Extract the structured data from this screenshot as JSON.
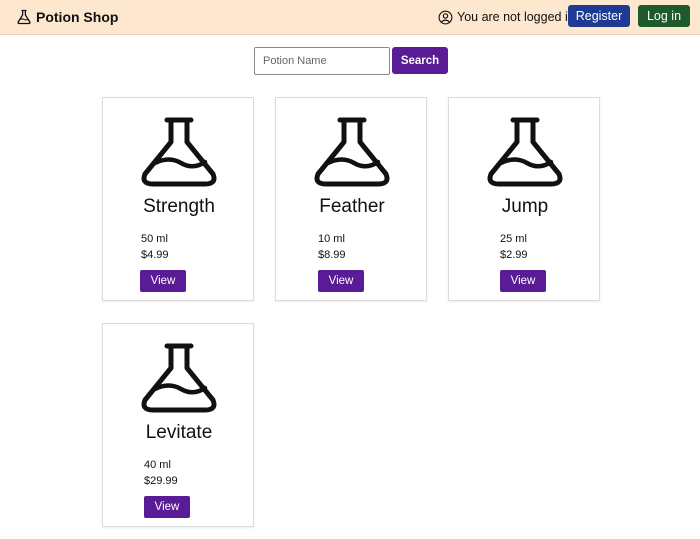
{
  "navbar": {
    "brand": "Potion Shop",
    "brand_icon": "flask-icon",
    "status_text": "You are not logged in",
    "status_icon": "user-circle-icon",
    "register_label": "Register",
    "login_label": "Log in",
    "colors": {
      "background": "#fde8cf",
      "register": "#1f3a93",
      "login": "#1e5a2c"
    }
  },
  "search": {
    "placeholder": "Potion Name",
    "value": "",
    "button_label": "Search",
    "button_color": "#5a1b96"
  },
  "products": [
    {
      "name": "Strength",
      "volume": "50 ml",
      "price": "$4.99",
      "view_label": "View",
      "icon": "flask-icon"
    },
    {
      "name": "Feather",
      "volume": "10 ml",
      "price": "$8.99",
      "view_label": "View",
      "icon": "flask-icon"
    },
    {
      "name": "Jump",
      "volume": "25 ml",
      "price": "$2.99",
      "view_label": "View",
      "icon": "flask-icon"
    },
    {
      "name": "Levitate",
      "volume": "40 ml",
      "price": "$29.99",
      "view_label": "View",
      "icon": "flask-icon"
    }
  ]
}
